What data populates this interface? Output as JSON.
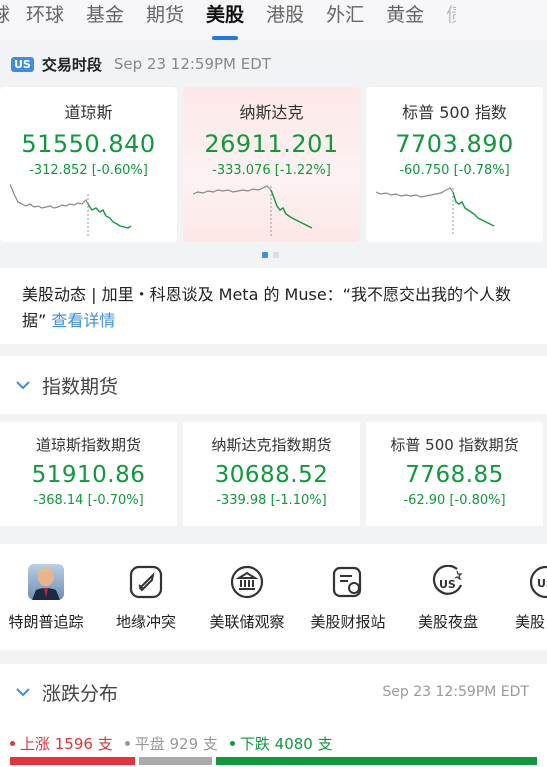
{
  "tabs": [
    {
      "label": "环球",
      "active": false
    },
    {
      "label": "基金",
      "active": false
    },
    {
      "label": "期货",
      "active": false
    },
    {
      "label": "美股",
      "active": true
    },
    {
      "label": "港股",
      "active": false
    },
    {
      "label": "外汇",
      "active": false
    },
    {
      "label": "黄金",
      "active": false
    }
  ],
  "session": {
    "badge": "US",
    "title": "交易时段",
    "time": "Sep 23 12:59PM EDT"
  },
  "indices": [
    {
      "name": "道琼斯",
      "value": "51550.840",
      "change": "-312.852 [-0.60%]"
    },
    {
      "name": "纳斯达克",
      "value": "26911.201",
      "change": "-333.076 [-1.22%]"
    },
    {
      "name": "标普 500 指数",
      "value": "7703.890",
      "change": "-60.750 [-0.78%]"
    }
  ],
  "news": {
    "text": "美股动态 | 加里・科恩谈及 Meta 的 Muse：“我不愿交出我的个人数据”",
    "link": "查看详情"
  },
  "futures": {
    "title": "指数期货",
    "items": [
      {
        "name": "道琼斯指数期货",
        "value": "51910.86",
        "change": "-368.14 [-0.70%]"
      },
      {
        "name": "纳斯达克指数期货",
        "value": "30688.52",
        "change": "-339.98 [-1.10%]"
      },
      {
        "name": "标普 500 指数期货",
        "value": "7768.85",
        "change": "-62.90 [-0.80%]"
      }
    ]
  },
  "shortcuts": [
    {
      "label": "特朗普追踪",
      "icon": "avatar"
    },
    {
      "label": "地缘冲突",
      "icon": "missile-icon"
    },
    {
      "label": "美联储观察",
      "icon": "bank-icon"
    },
    {
      "label": "美股财报站",
      "icon": "report-icon"
    },
    {
      "label": "美股夜盘",
      "icon": "us-night-icon"
    },
    {
      "label": "美股",
      "icon": "us-icon"
    }
  ],
  "distribution": {
    "title": "涨跌分布",
    "time": "Sep 23 12:59PM EDT",
    "up": "上涨 1596 支",
    "flat": "平盘 929 支",
    "down": "下跌 4080 支",
    "up_count": 1596,
    "flat_count": 929,
    "down_count": 4080
  },
  "colors": {
    "up": "#e8313a",
    "down": "#0e9a3a",
    "flat": "#999999",
    "accent": "#3c8ee6"
  }
}
